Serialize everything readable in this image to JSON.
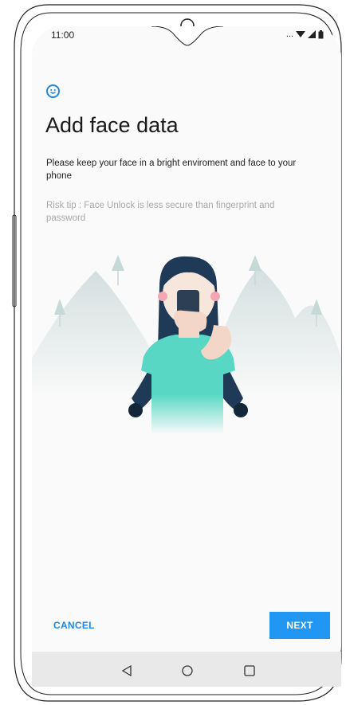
{
  "status_bar": {
    "time": "11:00",
    "icons": [
      "more-dots-icon",
      "wifi-icon",
      "signal-icon",
      "battery-icon"
    ],
    "dots": "..."
  },
  "header": {
    "icon": "face-smile-icon",
    "title": "Add face data"
  },
  "content": {
    "description": "Please keep your face in a bright enviroment and face to your phone",
    "risk_tip": "Risk tip : Face Unlock is less secure than fingerprint and password"
  },
  "buttons": {
    "cancel": "CANCEL",
    "next": "NEXT"
  },
  "nav_bar": {
    "items": [
      "back-icon",
      "home-icon",
      "recents-icon"
    ]
  },
  "colors": {
    "accent": "#2196f3",
    "text_link": "#1e88e5",
    "risk_text": "#a9a9a9",
    "background": "#fafafa",
    "nav_bar": "#e9e9e9",
    "hair": "#1f3a57",
    "shirt": "#58d8c4",
    "mountains": "#dfe7e7"
  }
}
